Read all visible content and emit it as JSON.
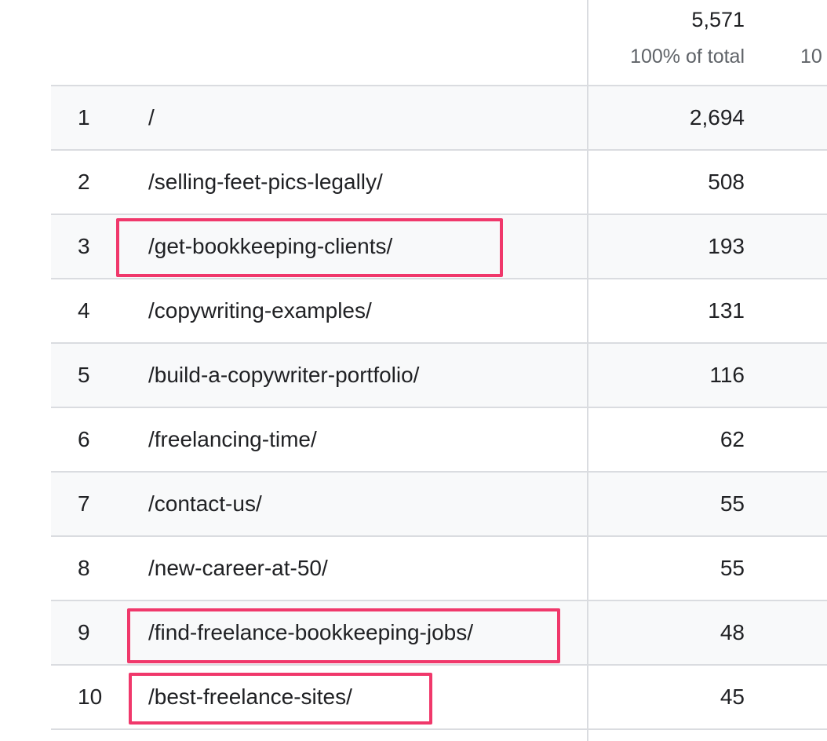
{
  "header": {
    "total": "5,571",
    "pct_of_total": "100% of total",
    "pct_of_total_next": "10"
  },
  "rows": [
    {
      "index": "1",
      "path": "/",
      "value": "2,694",
      "highlighted": false
    },
    {
      "index": "2",
      "path": "/selling-feet-pics-legally/",
      "value": "508",
      "highlighted": false
    },
    {
      "index": "3",
      "path": "/get-bookkeeping-clients/",
      "value": "193",
      "highlighted": true
    },
    {
      "index": "4",
      "path": "/copywriting-examples/",
      "value": "131",
      "highlighted": false
    },
    {
      "index": "5",
      "path": "/build-a-copywriter-portfolio/",
      "value": "116",
      "highlighted": false
    },
    {
      "index": "6",
      "path": "/freelancing-time/",
      "value": "62",
      "highlighted": false
    },
    {
      "index": "7",
      "path": "/contact-us/",
      "value": "55",
      "highlighted": false
    },
    {
      "index": "8",
      "path": "/new-career-at-50/",
      "value": "55",
      "highlighted": false
    },
    {
      "index": "9",
      "path": "/find-freelance-bookkeeping-jobs/",
      "value": "48",
      "highlighted": true
    },
    {
      "index": "10",
      "path": "/best-freelance-sites/",
      "value": "45",
      "highlighted": true
    }
  ],
  "colors": {
    "highlight": "#f0386b",
    "divider": "#dadce0",
    "alt_row": "#f8f9fa"
  }
}
